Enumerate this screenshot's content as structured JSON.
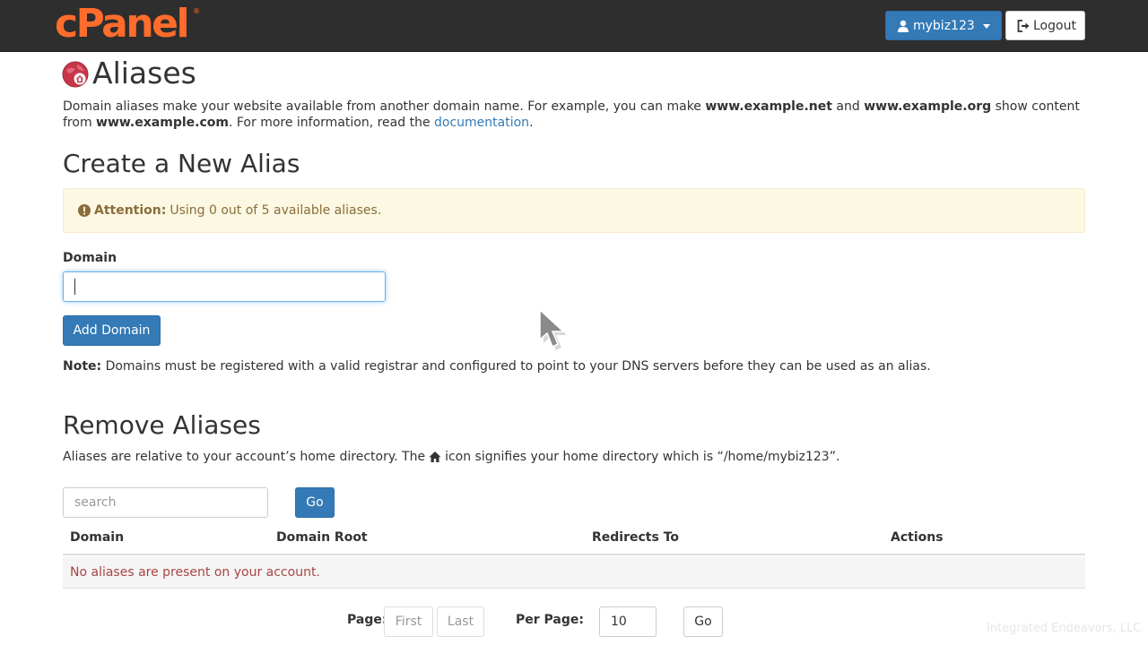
{
  "header": {
    "logo": "cPanel",
    "logo_mark": "®",
    "user_label": "mybiz123",
    "logout_label": "Logout"
  },
  "page": {
    "title": "Aliases",
    "intro_part1": "Domain aliases make your website available from another domain name. For example, you can make ",
    "intro_bold1": "www.example.net",
    "intro_part2": " and ",
    "intro_bold2": "www.example.org",
    "intro_part3": " show content from ",
    "intro_bold3": "www.example.com",
    "intro_part4": ". For more information, read the ",
    "intro_link": "documentation",
    "intro_part5": "."
  },
  "create": {
    "heading": "Create a New Alias",
    "alert_label": "Attention:",
    "alert_text": "Using 0 out of 5 available aliases.",
    "domain_label": "Domain",
    "domain_value": "",
    "add_button": "Add Domain",
    "note_label": "Note:",
    "note_text": " Domains must be registered with a valid registrar and configured to point to your DNS servers before they can be used as an alias."
  },
  "remove": {
    "heading": "Remove Aliases",
    "subtext_part1": "Aliases are relative to your account’s home directory. The",
    "subtext_part2": "icon signifies your home directory which is “/home/mybiz123”.",
    "search_placeholder": "search",
    "go_button": "Go",
    "columns": [
      "Domain",
      "Domain Root",
      "Redirects To",
      "Actions"
    ],
    "empty_message": "No aliases are present on your account."
  },
  "pagination": {
    "page_label": "Page:",
    "first_label": "First",
    "last_label": "Last",
    "per_page_label": "Per Page:",
    "per_page_value": "10",
    "go_label": "Go"
  },
  "watermark": "Integrated Endeavors, LLC",
  "colors": {
    "topbar": "#2e2e2e",
    "brand": "#ff6c2c",
    "primary": "#337ab7",
    "alert_bg": "#fcf8e3",
    "alert_text": "#8a6d3b",
    "danger_text": "#a94442"
  },
  "icons": {
    "user": "user-icon",
    "logout": "logout-icon",
    "page": "aliases-icon",
    "attention": "exclamation-circle-icon",
    "home": "home-icon",
    "cursor": "mouse-pointer-icon"
  }
}
